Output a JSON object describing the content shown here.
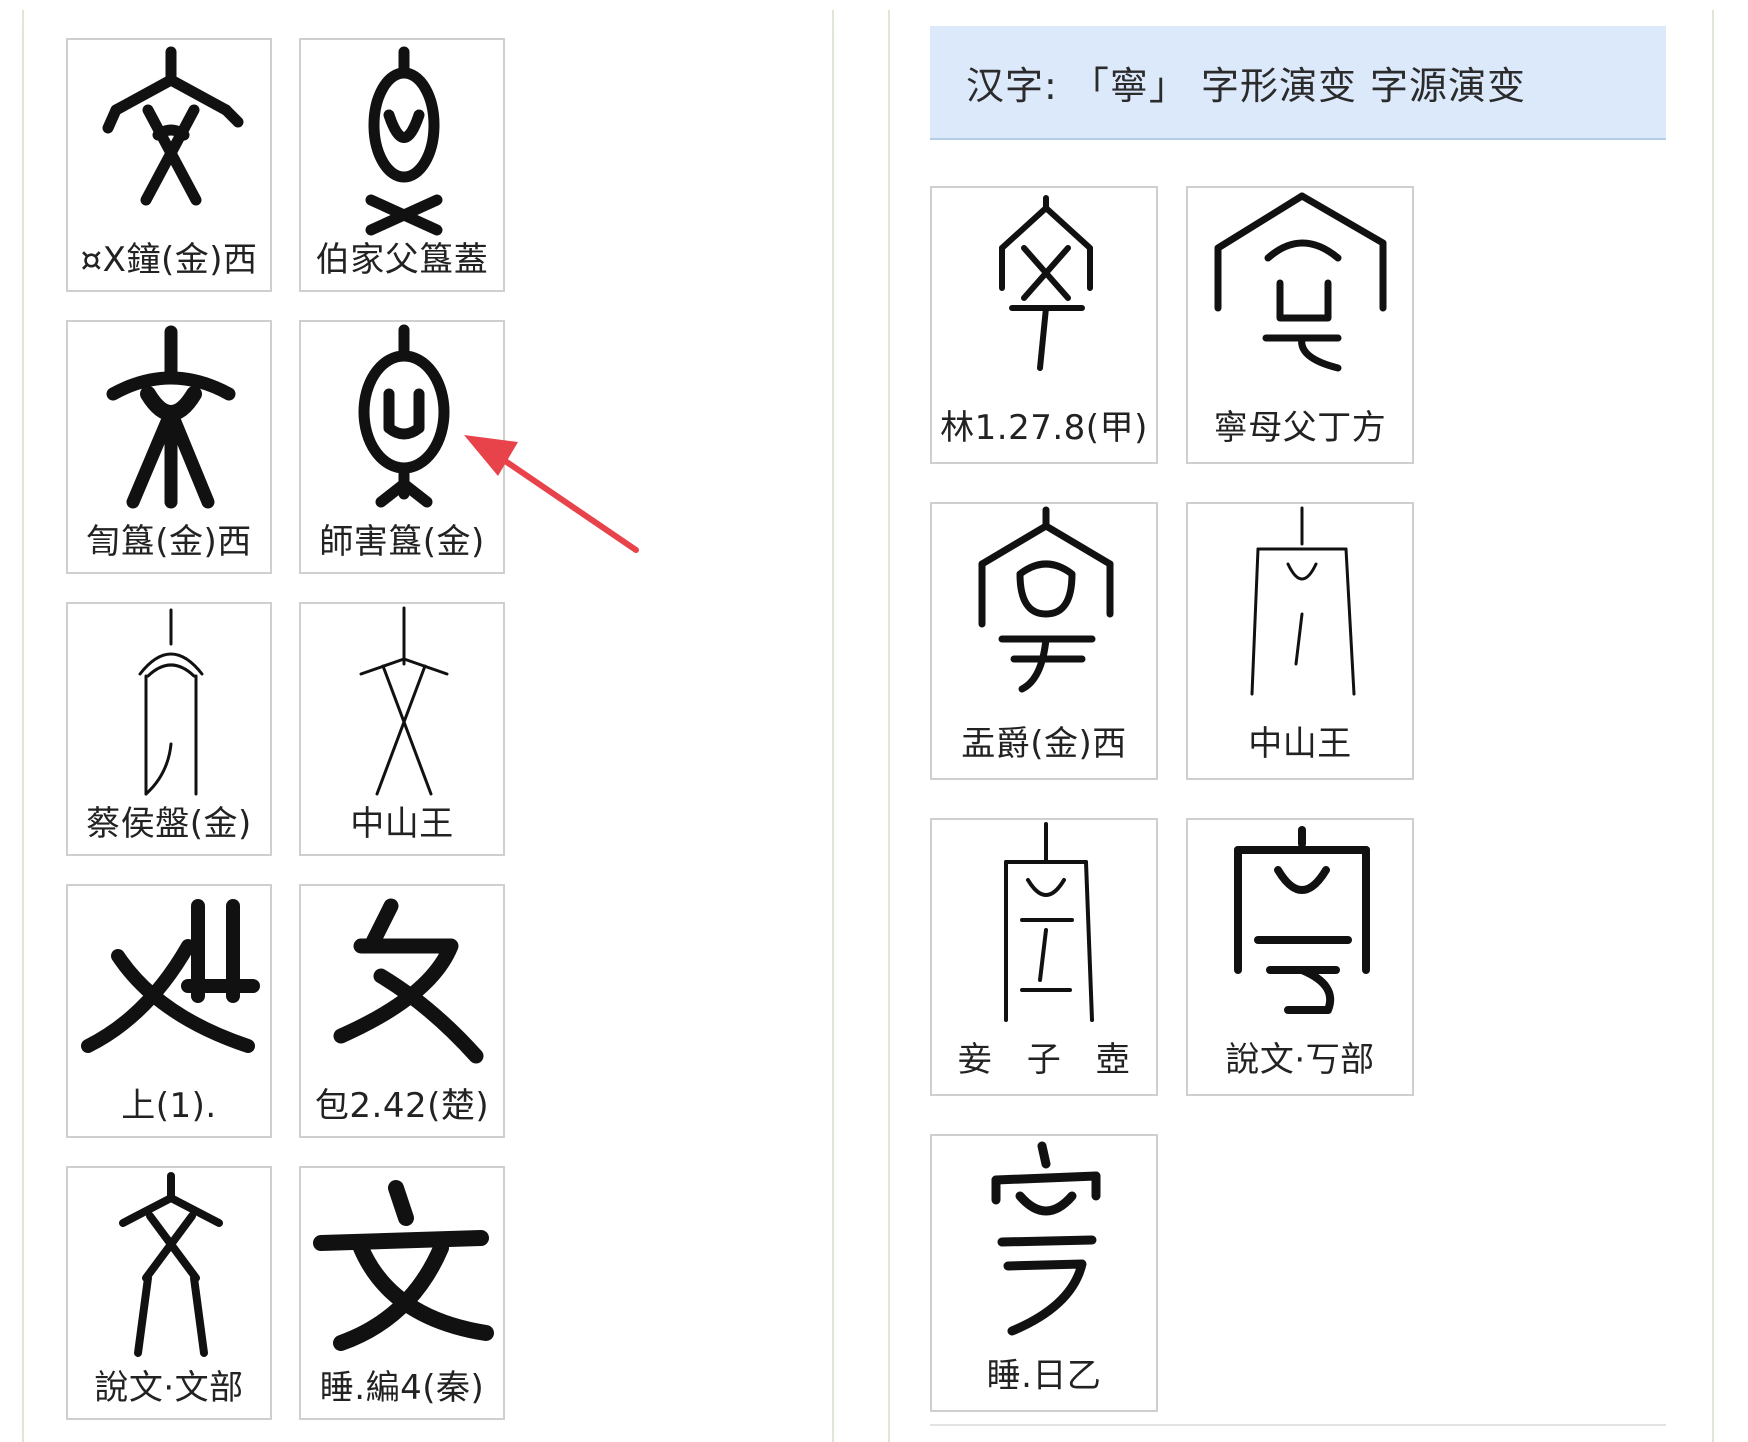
{
  "left_cards": [
    {
      "caption": "¤X鐘(金)西"
    },
    {
      "caption": "伯家父簋蓋"
    },
    {
      "caption": "訇簋(金)西"
    },
    {
      "caption": "師害簋(金)"
    },
    {
      "caption": "蔡侯盤(金)"
    },
    {
      "caption": "中山王"
    },
    {
      "caption": "上(1)."
    },
    {
      "caption": "包2.42(楚)"
    },
    {
      "caption": "說文·文部"
    },
    {
      "caption": "睡.編4(秦)"
    }
  ],
  "title": "汉字: 「寧」 字形演变 字源演变",
  "right_cards": [
    {
      "caption": "林1.27.8(甲)"
    },
    {
      "caption": "寧母父丁方"
    },
    {
      "caption": "盂爵(金)西"
    },
    {
      "caption": "中山王"
    },
    {
      "caption": "妾　子　壺"
    },
    {
      "caption": "說文·丂部"
    },
    {
      "caption": "睡.日乙"
    }
  ],
  "annotation": {
    "arrow_color": "#e8434b"
  }
}
